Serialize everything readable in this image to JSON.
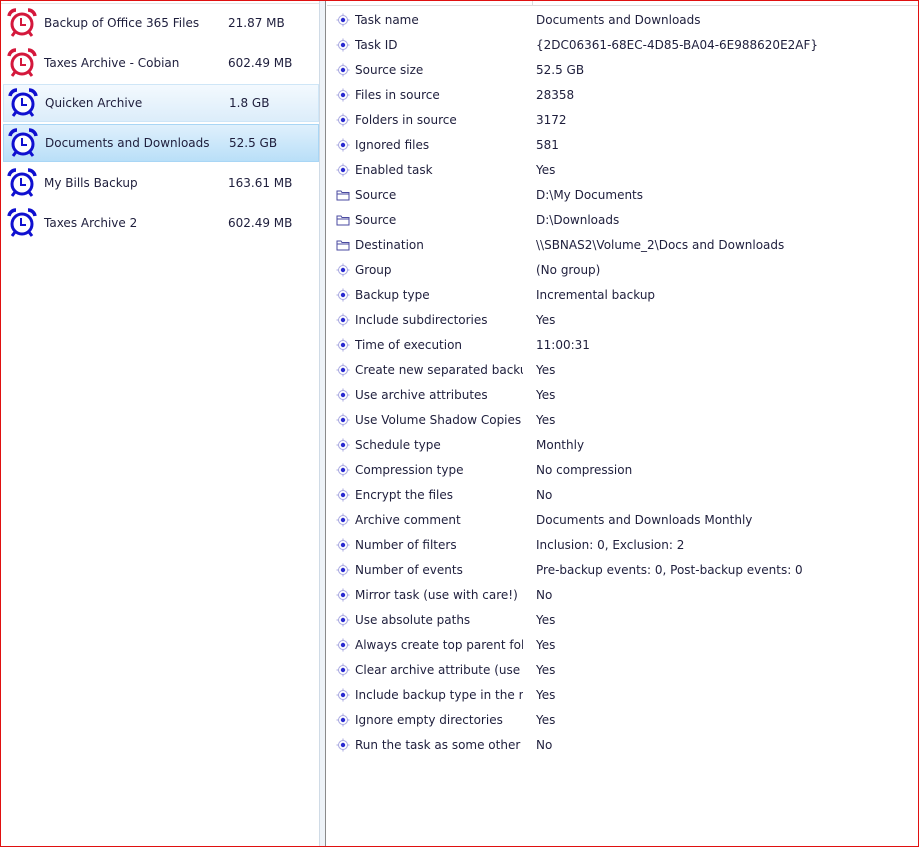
{
  "colors": {
    "frame": "#e01010",
    "alarm_red": "#d4183c",
    "alarm_blue": "#1010d0",
    "selection": "#b9dff8"
  },
  "tasks": [
    {
      "name": "Backup of Office 365 Files",
      "size": "21.87 MB",
      "icon": "alarm-clock-red",
      "state": "normal"
    },
    {
      "name": "Taxes Archive - Cobian",
      "size": "602.49 MB",
      "icon": "alarm-clock-red",
      "state": "normal"
    },
    {
      "name": "Quicken Archive",
      "size": "1.8 GB",
      "icon": "alarm-clock-blue",
      "state": "hover"
    },
    {
      "name": "Documents and Downloads",
      "size": "52.5 GB",
      "icon": "alarm-clock-blue",
      "state": "selected"
    },
    {
      "name": "My Bills Backup",
      "size": "163.61 MB",
      "icon": "alarm-clock-blue",
      "state": "normal"
    },
    {
      "name": "Taxes Archive 2",
      "size": "602.49 MB",
      "icon": "alarm-clock-blue",
      "state": "normal"
    }
  ],
  "properties": [
    {
      "name": "Task name",
      "value": "Documents and Downloads",
      "icon": "property"
    },
    {
      "name": "Task ID",
      "value": "{2DC06361-68EC-4D85-BA04-6E988620E2AF}",
      "icon": "property"
    },
    {
      "name": "Source size",
      "value": "52.5 GB",
      "icon": "property"
    },
    {
      "name": "Files in source",
      "value": "28358",
      "icon": "property"
    },
    {
      "name": "Folders in source",
      "value": "3172",
      "icon": "property"
    },
    {
      "name": "Ignored files",
      "value": "581",
      "icon": "property"
    },
    {
      "name": "Enabled task",
      "value": "Yes",
      "icon": "property"
    },
    {
      "name": "Source",
      "value": "D:\\My Documents",
      "icon": "folder"
    },
    {
      "name": "Source",
      "value": "D:\\Downloads",
      "icon": "folder"
    },
    {
      "name": "Destination",
      "value": "\\\\SBNAS2\\Volume_2\\Docs and Downloads",
      "icon": "folder"
    },
    {
      "name": "Group",
      "value": "(No group)",
      "icon": "property"
    },
    {
      "name": "Backup type",
      "value": "Incremental backup",
      "icon": "property"
    },
    {
      "name": "Include subdirectories",
      "value": "Yes",
      "icon": "property"
    },
    {
      "name": "Time of execution",
      "value": "11:00:31",
      "icon": "property"
    },
    {
      "name": "Create new separated backups",
      "value": "Yes",
      "icon": "property"
    },
    {
      "name": "Use archive attributes",
      "value": "Yes",
      "icon": "property"
    },
    {
      "name": "Use Volume Shadow Copies",
      "value": "Yes",
      "icon": "property"
    },
    {
      "name": "Schedule type",
      "value": "Monthly",
      "icon": "property"
    },
    {
      "name": "Compression type",
      "value": "No compression",
      "icon": "property"
    },
    {
      "name": "Encrypt the files",
      "value": "No",
      "icon": "property"
    },
    {
      "name": "Archive comment",
      "value": "Documents and Downloads Monthly",
      "icon": "property"
    },
    {
      "name": "Number of filters",
      "value": "Inclusion: 0, Exclusion: 2",
      "icon": "property"
    },
    {
      "name": "Number of events",
      "value": "Pre-backup events: 0, Post-backup events: 0",
      "icon": "property"
    },
    {
      "name": "Mirror task (use with care!)",
      "value": "No",
      "icon": "property"
    },
    {
      "name": "Use absolute paths",
      "value": "Yes",
      "icon": "property"
    },
    {
      "name": "Always create top parent folder",
      "value": "Yes",
      "icon": "property"
    },
    {
      "name": "Clear archive attribute (use with",
      "value": "Yes",
      "icon": "property"
    },
    {
      "name": "Include backup type in the name",
      "value": "Yes",
      "icon": "property"
    },
    {
      "name": "Ignore empty directories",
      "value": "Yes",
      "icon": "property"
    },
    {
      "name": "Run the task as some other user",
      "value": "No",
      "icon": "property"
    }
  ]
}
